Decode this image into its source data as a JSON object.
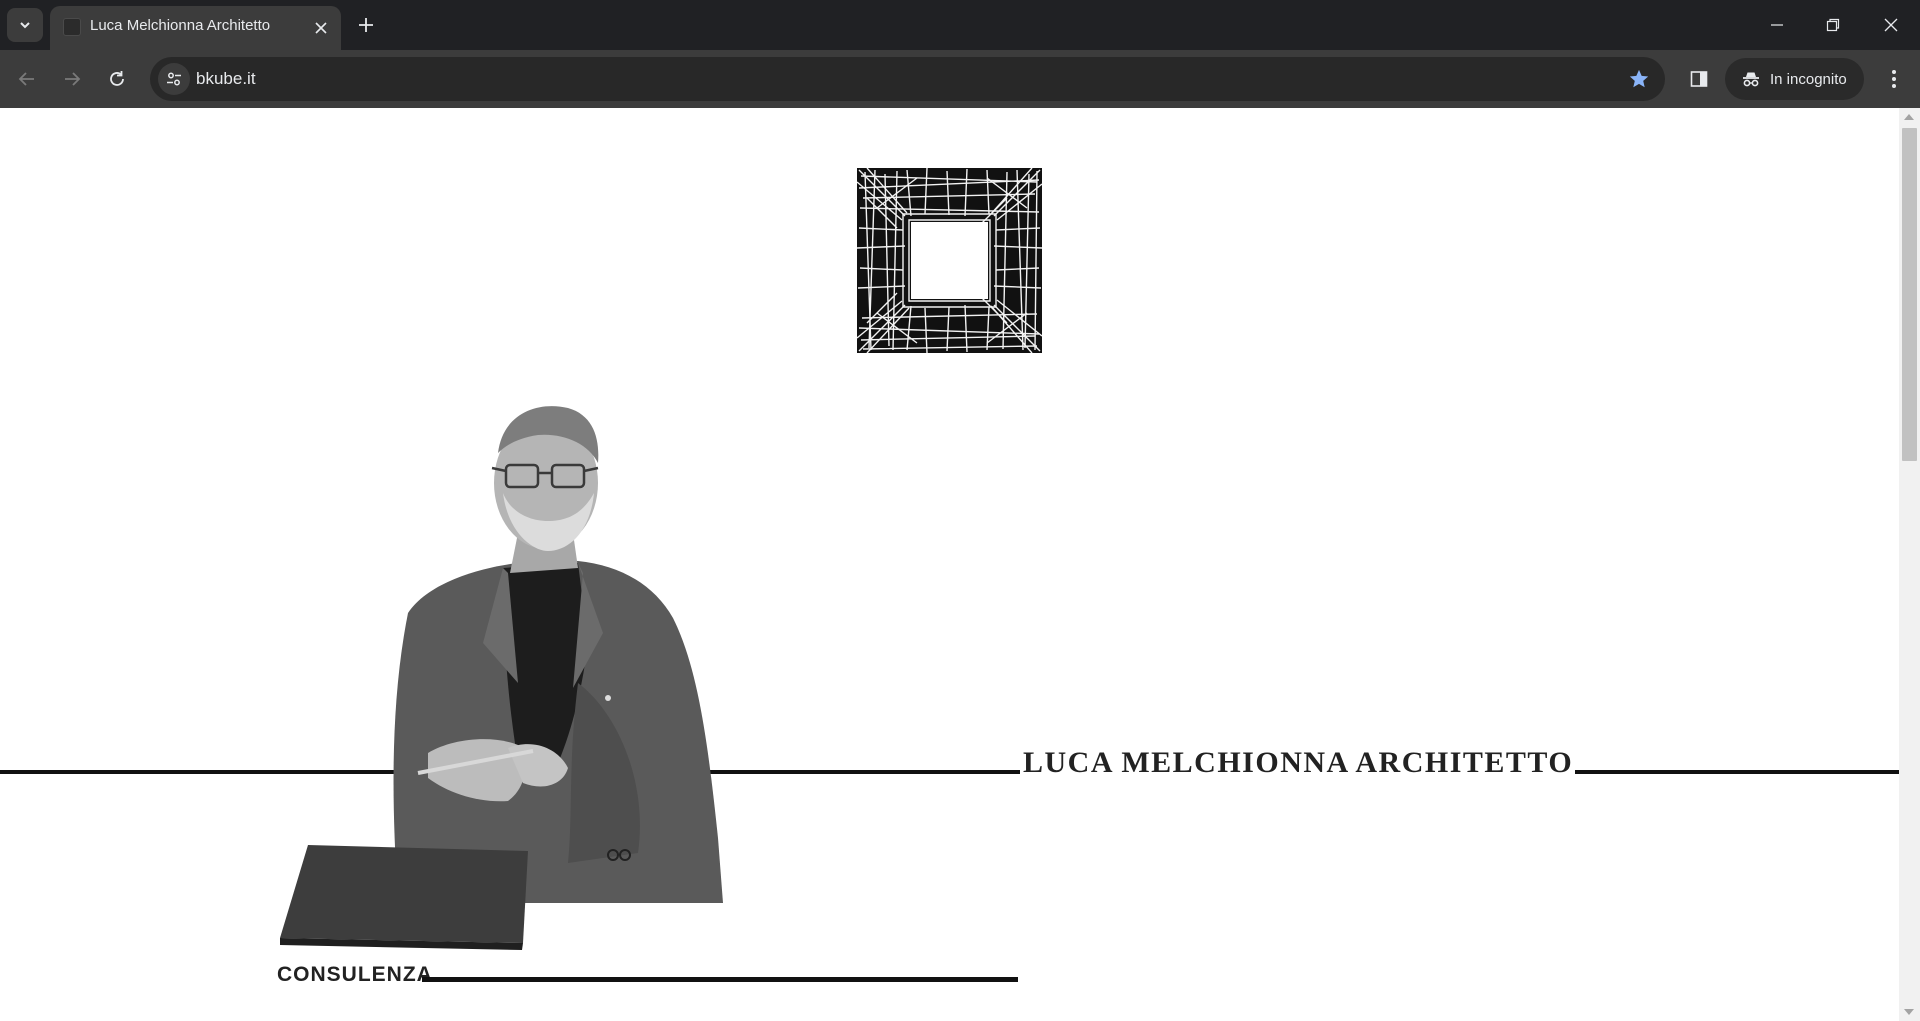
{
  "browser": {
    "tab": {
      "title": "Luca Melchionna Architetto"
    },
    "toolbar": {
      "url": "bkube.it",
      "incognito_label": "In incognito"
    },
    "icons": {
      "tab_search": "chevron-down-icon",
      "tab_close": "close-icon",
      "new_tab": "plus-icon",
      "minimize": "minimize-icon",
      "restore": "restore-icon",
      "close_window": "close-icon",
      "back": "arrow-left-icon",
      "forward": "arrow-right-icon",
      "reload": "reload-icon",
      "site_info": "tune-icon",
      "bookmark": "star-icon",
      "side_panel": "side-panel-icon",
      "incognito": "incognito-icon",
      "menu": "kebab-menu-icon"
    },
    "colors": {
      "tabbar_bg": "#202124",
      "toolbar_bg": "#3c3c3c",
      "bookmark_star": "#8ab4f8"
    }
  },
  "page": {
    "hero": {
      "title": "LUCA MELCHIONNA ARCHITETTO"
    },
    "sections": [
      {
        "label": "CONSULENZA"
      }
    ]
  }
}
